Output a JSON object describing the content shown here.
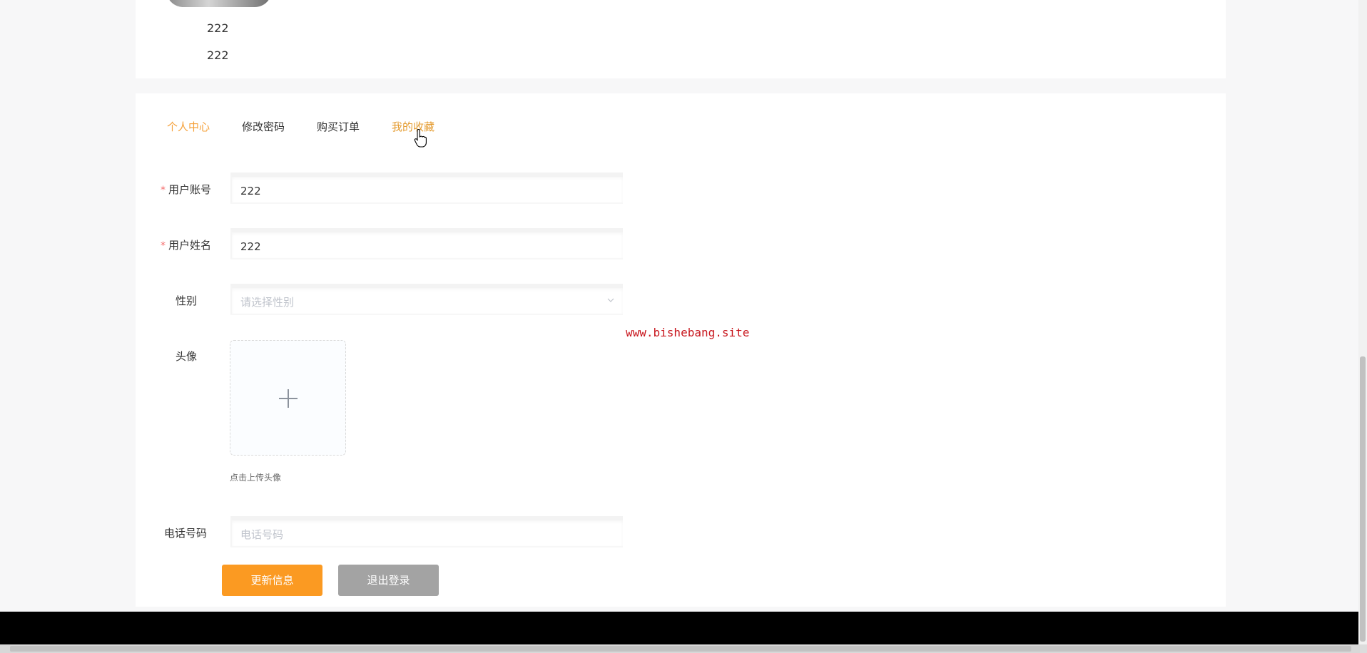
{
  "profile": {
    "line1": "222",
    "line2": "222"
  },
  "tabs": [
    {
      "label": "个人中心",
      "state": "active"
    },
    {
      "label": "修改密码",
      "state": "normal"
    },
    {
      "label": "购买订单",
      "state": "normal"
    },
    {
      "label": "我的收藏",
      "state": "hover"
    }
  ],
  "form": {
    "account": {
      "label": "用户账号",
      "required": "*",
      "value": "222"
    },
    "name": {
      "label": "用户姓名",
      "required": "*",
      "value": "222"
    },
    "gender": {
      "label": "性别",
      "placeholder": "请选择性别"
    },
    "avatar": {
      "label": "头像",
      "tip": "点击上传头像"
    },
    "phone": {
      "label": "电话号码",
      "placeholder": "电话号码"
    }
  },
  "buttons": {
    "update": "更新信息",
    "logout": "退出登录"
  },
  "watermark": "www.bishebang.site",
  "colors": {
    "accent": "#f5a13a",
    "update_button": "#fb9a22",
    "logout_button": "#a3a3a3",
    "required": "#f56c6c",
    "watermark": "#c8161d"
  },
  "icons": {
    "upload": "plus-icon",
    "select": "chevron-down-icon",
    "cursor": "hand-pointer-icon"
  }
}
